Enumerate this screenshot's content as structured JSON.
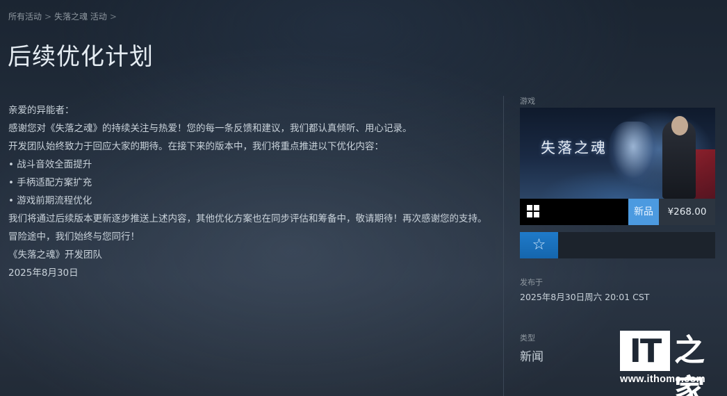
{
  "breadcrumb": {
    "items": [
      "所有活动",
      "失落之魂 活动"
    ],
    "separator": ">"
  },
  "page_title": "后续优化计划",
  "body": {
    "paragraphs": [
      "亲爱的异能者：",
      "感谢您对《失落之魂》的持续关注与热爱！您的每一条反馈和建议，我们都认真倾听、用心记录。",
      "开发团队始终致力于回应大家的期待。在接下来的版本中，我们将重点推进以下优化内容：",
      "• 战斗音效全面提升",
      "• 手柄适配方案扩充",
      "• 游戏前期流程优化",
      "我们将通过后续版本更新逐步推送上述内容，其他优化方案也在同步评估和筹备中，敬请期待！再次感谢您的支持。冒险途中，我们始终与您同行！",
      "《失落之魂》开发团队",
      "2025年8月30日"
    ]
  },
  "sidebar": {
    "game_label": "游戏",
    "game_logo_text": "失落之魂",
    "platform_icon": "windows-icon",
    "new_badge": "新品",
    "price": "¥268.00",
    "wishlist_icon": "☆",
    "published_label": "发布于",
    "published_value": "2025年8月30日周六  20:01 CST",
    "type_label": "类型",
    "type_value": "新闻"
  },
  "watermark": {
    "it": "IT",
    "zh": "之家",
    "url": "www.ithome.com"
  },
  "colors": {
    "accent_blue": "#4c9ae0",
    "wishlist_blue": "#1f7ac9",
    "background": "#222d3b"
  }
}
